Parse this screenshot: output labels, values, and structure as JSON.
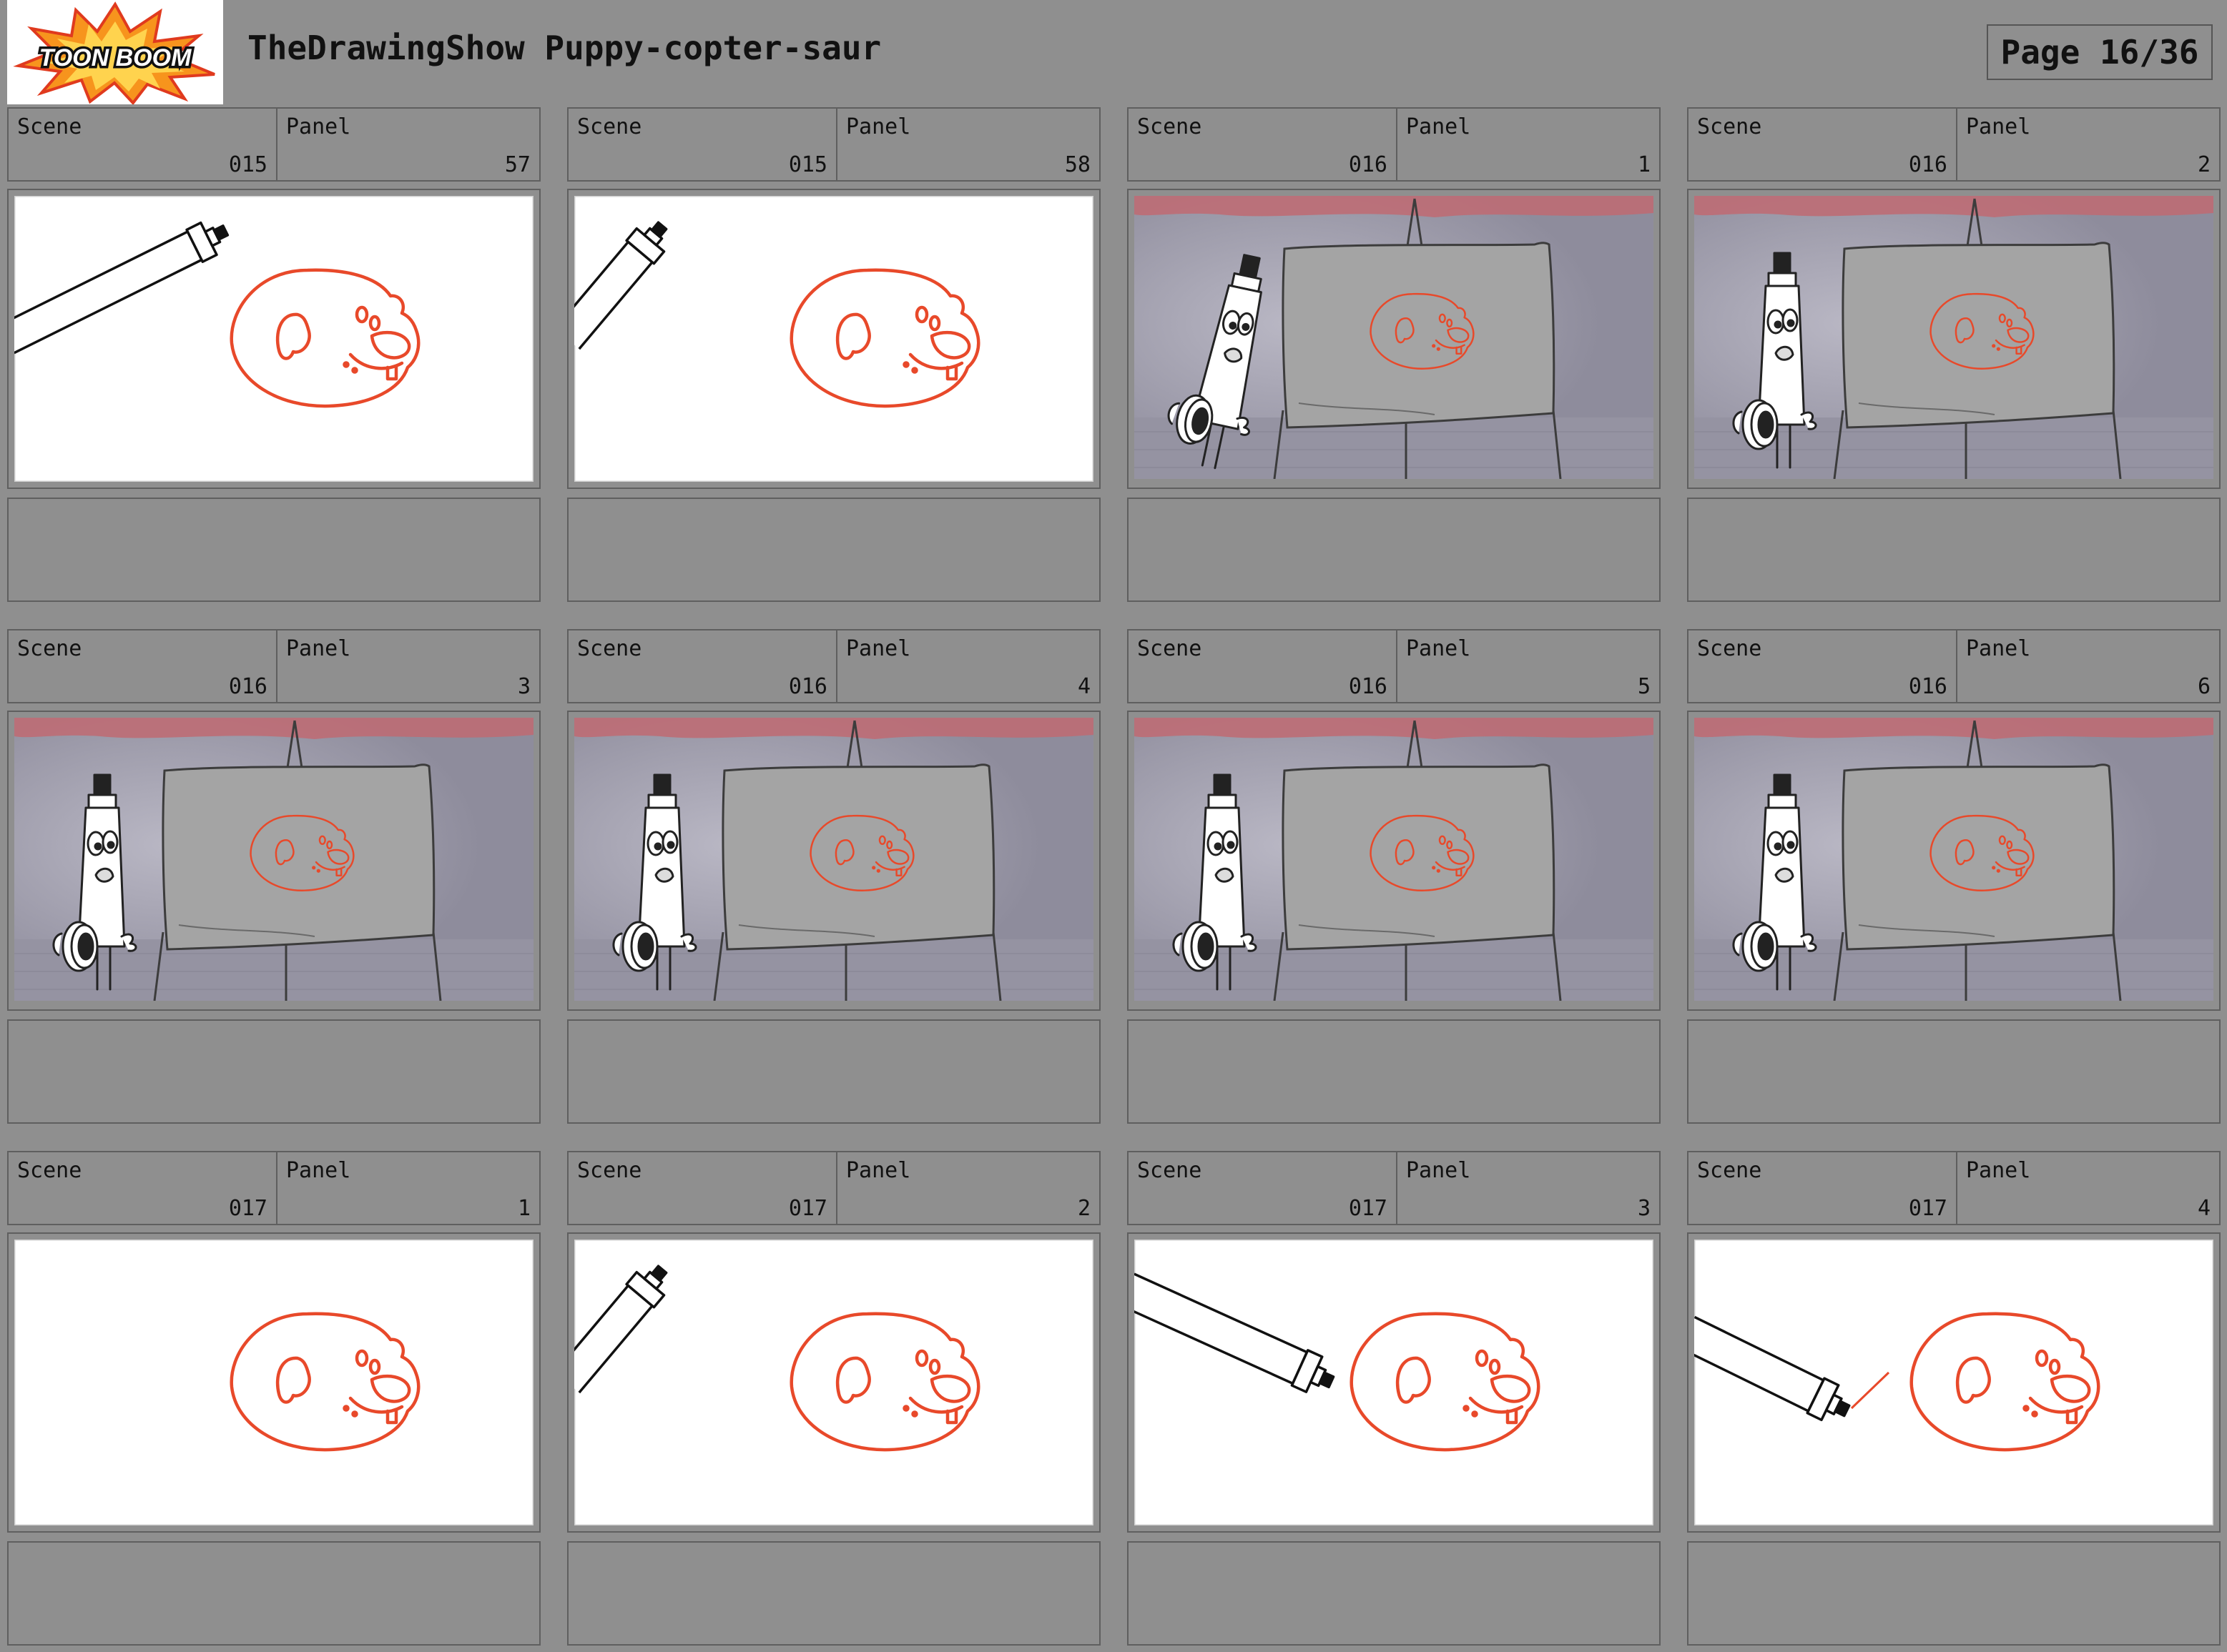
{
  "header": {
    "logo_text": "TOON BOOM",
    "title": "TheDrawingShow Puppy-copter-saur",
    "page_label": "Page 16/36"
  },
  "labels": {
    "scene": "Scene",
    "panel": "Panel"
  },
  "colors": {
    "background": "#8f8f8f",
    "border": "#5f5f5f",
    "sketch_red": "#e8492a",
    "logo_orange": "#f7941d"
  },
  "panels": [
    {
      "scene": "015",
      "panel": "57",
      "art": "white-marker-long"
    },
    {
      "scene": "015",
      "panel": "58",
      "art": "white-marker-short"
    },
    {
      "scene": "016",
      "panel": "1",
      "art": "stage-lean"
    },
    {
      "scene": "016",
      "panel": "2",
      "art": "stage-stand"
    },
    {
      "scene": "016",
      "panel": "3",
      "art": "stage-stand"
    },
    {
      "scene": "016",
      "panel": "4",
      "art": "stage-stand"
    },
    {
      "scene": "016",
      "panel": "5",
      "art": "stage-stand"
    },
    {
      "scene": "016",
      "panel": "6",
      "art": "stage-stand"
    },
    {
      "scene": "017",
      "panel": "1",
      "art": "white-empty"
    },
    {
      "scene": "017",
      "panel": "2",
      "art": "white-marker-short"
    },
    {
      "scene": "017",
      "panel": "3",
      "art": "white-marker-diag"
    },
    {
      "scene": "017",
      "panel": "4",
      "art": "white-marker-line"
    }
  ]
}
